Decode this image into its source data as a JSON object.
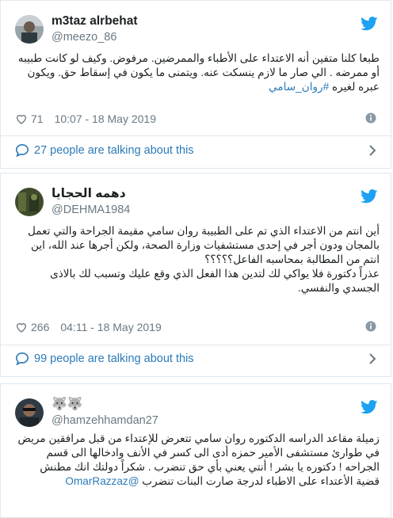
{
  "tweets": [
    {
      "display_name": "m3taz alrbehat",
      "handle": "@meezo_86",
      "text": "طبعا كلنا متفين أنه الاعتداء على الأطباء والممرضين. مرفوض. وكيف لو كانت طبيبه أو ممرضه . الي صار ما لازم ينسكت عنه. ويتمنى ما يكون في إسقاط حق. ويكون عبره لغيره",
      "hashtag": "#روان_سامي",
      "likes": "71",
      "timestamp": "10:07 - 18 May 2019",
      "talking": "27 people are talking about this"
    },
    {
      "display_name": "دهمه الحجايا",
      "handle": "@DEHMA1984",
      "text": "أين انتم من الاعتداء الذي تم على الطبيبة روان سامي مقيمة الجراحة والتي تعمل بالمجان ودون أجر في إحدى مستشفيات وزارة الصحة، ولكن أجرها عند الله، اين انتم من المطالبة بمحاسبه الفاعل؟؟؟؟؟",
      "text2": "عذراً دكتورة فلا يواكي لك لتدين هذا الفعل الذي وقع عليك وتسبب لك بالاذى الجسدي والنفسي.",
      "likes": "266",
      "timestamp": "04:11 - 18 May 2019",
      "talking": "99 people are talking about this"
    },
    {
      "display_name": "🐺🐺",
      "handle": "@hamzehhamdan27",
      "text": "زميلة مقاعد الدراسه الدكتوره روان سامي تتعرض للإعتداء من قبل مرافقين مريض في طوارئ مستشفى الأمير حمزه أدى الى كسر في الأنف وادخالها الى قسم الجراحه ! دكتوره يا بشر ! أنتي يعني بأي حق تنضرب . شكراً دولتك انك مطنش قضية الأعتداء على الاطباء لدرجة صارت البنات تنضرب",
      "mention": "@OmarRazzaz"
    }
  ],
  "icons": {
    "brand": "twitter-bird-icon",
    "like": "heart-icon",
    "info": "info-icon",
    "talk": "speech-bubble-icon",
    "more": "chevron-right-icon"
  },
  "colors": {
    "link": "#2b7bb9",
    "brand": "#1da1f2",
    "meta": "#697882",
    "border": "#e1e8ed"
  }
}
